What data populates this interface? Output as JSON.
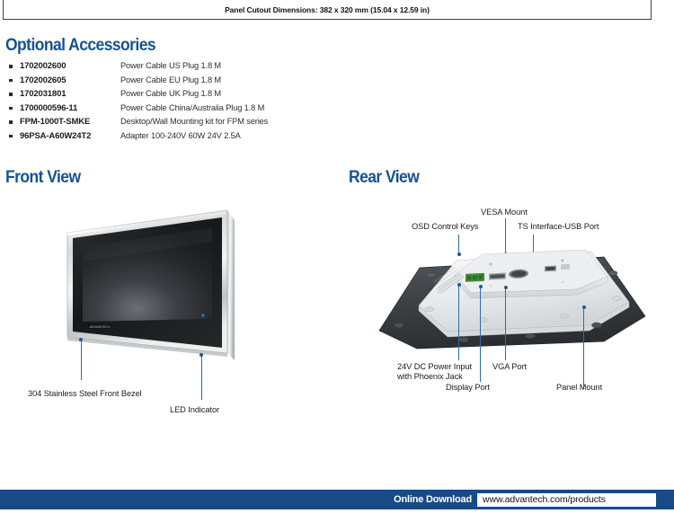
{
  "spec_box": {
    "cutout_dimensions": "Panel Cutout Dimensions: 382 x 320 mm (15.04 x 12.59 in)"
  },
  "sections": {
    "optional_accessories_heading": "Optional Accessories",
    "front_view_heading": "Front View",
    "rear_view_heading": "Rear View"
  },
  "accessories": [
    {
      "sku": "1702002600",
      "description": "Power Cable US Plug 1.8 M"
    },
    {
      "sku": "1702002605",
      "description": "Power Cable EU Plug 1.8 M"
    },
    {
      "sku": "1702031801",
      "description": "Power Cable UK Plug 1.8 M"
    },
    {
      "sku": "1700000596-11",
      "description": "Power Cable China/Australia Plug 1.8 M"
    },
    {
      "sku": "FPM-1000T-SMKE",
      "description": "Desktop/Wall Mounting kit for FPM series"
    },
    {
      "sku": "96PSA-A60W24T2",
      "description": "Adapter 100-240V 60W 24V 2.5A"
    }
  ],
  "front_view_callouts": {
    "bezel": "304 Stainless Steel Front Bezel",
    "led": "LED Indicator",
    "brand_logo": "ADVANTECH"
  },
  "rear_view_callouts": {
    "osd_control_keys": "OSD Control Keys",
    "vesa_mount": "VESA Mount",
    "ts_interface_usb": "TS Interface-USB Port",
    "dc_power_line1": "24V DC Power Input",
    "dc_power_line2": "with Phoenix Jack",
    "vga_port": "VGA Port",
    "display_port": "Display Port",
    "panel_mount": "Panel Mount"
  },
  "footer": {
    "online_download_label": "Online Download",
    "url": "www.advantech.com/products"
  },
  "colors": {
    "brand_blue": "#17528f",
    "footer_blue": "#174a86",
    "leader_blue": "#2f6ca3",
    "text_dark": "#1c1c1c"
  }
}
